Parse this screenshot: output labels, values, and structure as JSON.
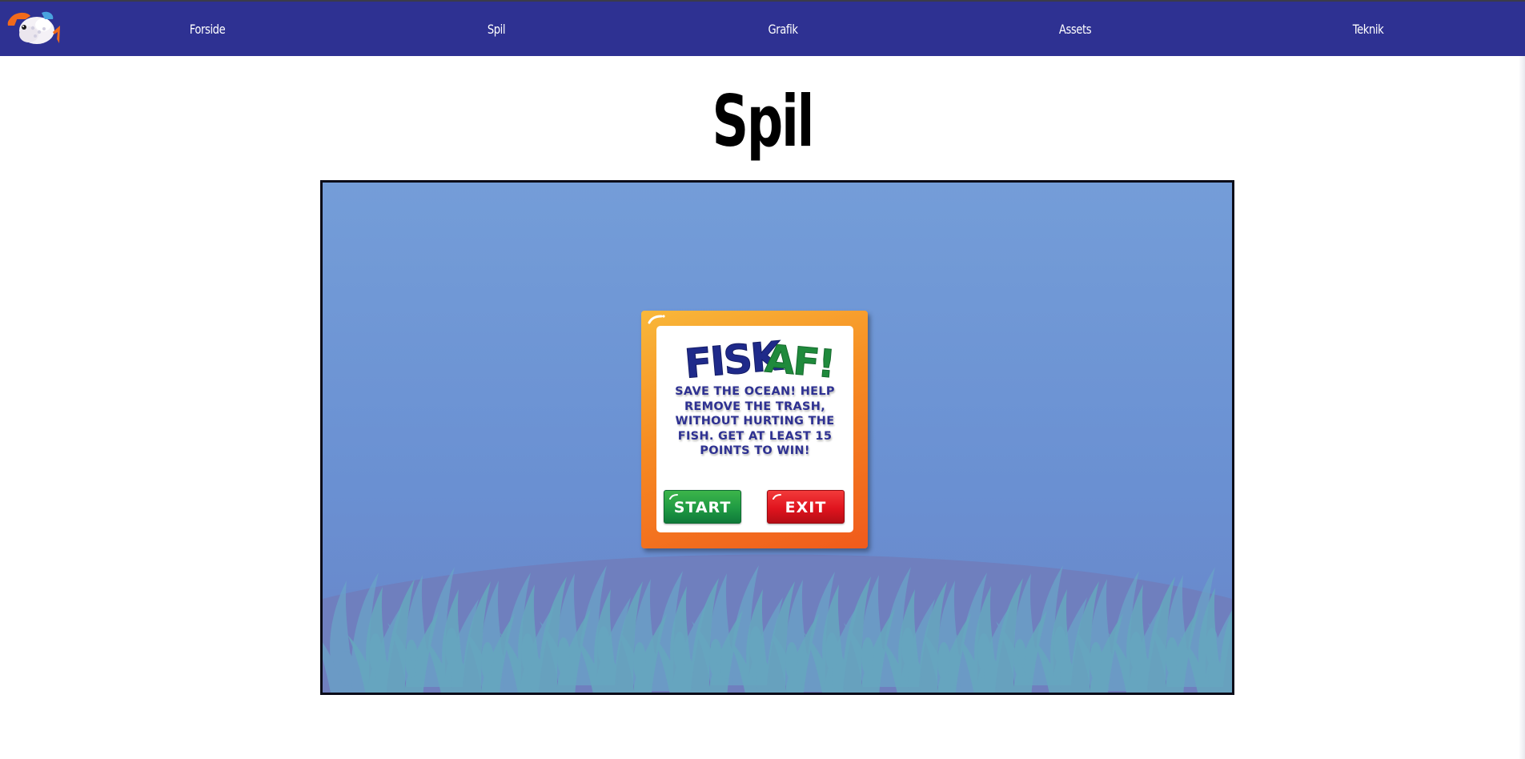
{
  "nav": {
    "logo_icon": "fish-logo-icon",
    "links": [
      "Forside",
      "Spil",
      "Grafik",
      "Assets",
      "Teknik"
    ]
  },
  "page": {
    "title": "Spil"
  },
  "game": {
    "background_colors": {
      "water_top": "#749dd8",
      "water_bottom": "#6885c8",
      "seaweed": "#6ba5c4",
      "sand": "#6f7fbe"
    },
    "dialog": {
      "title_part1": "FISK",
      "title_part2": "AF!",
      "title_part1_color": "#1f2a8a",
      "title_part2_color": "#1f8a3c",
      "description": "SAVE THE OCEAN! HELP REMOVE THE TRASH, WITHOUT HURTING THE FISH. GET AT LEAST 15 POINTS TO WIN!",
      "start_label": "START",
      "exit_label": "EXIT",
      "start_color": "#1f9a43",
      "exit_color": "#e0141e",
      "frame_color": "#f68a22"
    }
  },
  "colors": {
    "nav_background": "#2e3192",
    "page_background": "#ffffff",
    "frame_border": "#0b0b18"
  }
}
